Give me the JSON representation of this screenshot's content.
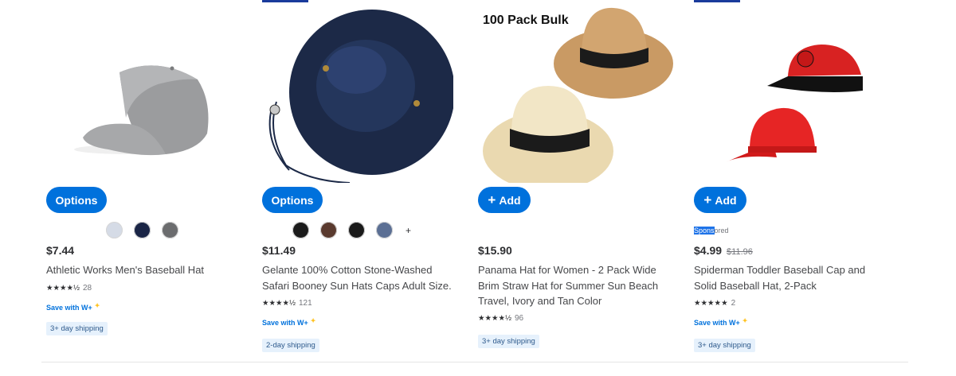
{
  "products": [
    {
      "button_label": "Options",
      "swatch_colors": [
        "#d5dbe6",
        "#1a2546",
        "#6b6c6e"
      ],
      "price": "$7.44",
      "title": "Athletic Works Men's Baseball Hat",
      "rating_count": "28",
      "save_with": "Save with W+",
      "shipping": "3+ day shipping"
    },
    {
      "button_label": "Options",
      "swatch_colors": [
        "#1b1b1b",
        "#5a3a2e",
        "#1a1a1a",
        "#5b6f94"
      ],
      "more_swatches": "+",
      "price": "$11.49",
      "title": "Gelante 100% Cotton Stone-Washed Safari Booney Sun Hats Caps Adult Size.",
      "rating_count": "121",
      "save_with": "Save with W+",
      "shipping": "2-day shipping"
    },
    {
      "image_text": "100 Pack Bulk",
      "button_label": "Add",
      "price": "$15.90",
      "title": "Panama Hat for Women - 2 Pack Wide Brim Straw Hat for Summer Sun Beach Travel, Ivory and Tan Color",
      "rating_count": "96",
      "shipping": "3+ day shipping"
    },
    {
      "button_label": "Add",
      "sponsored_hl": "Spons",
      "sponsored_rest": "ored",
      "price": "$4.99",
      "was_price": "$11.96",
      "title": "Spiderman Toddler Baseball Cap and Solid Baseball Hat, 2-Pack",
      "rating_count": "2",
      "save_with": "Save with W+",
      "shipping": "3+ day shipping"
    }
  ],
  "colors": {
    "accent": "#0071dc",
    "ship_bg": "#e6f1fc"
  }
}
